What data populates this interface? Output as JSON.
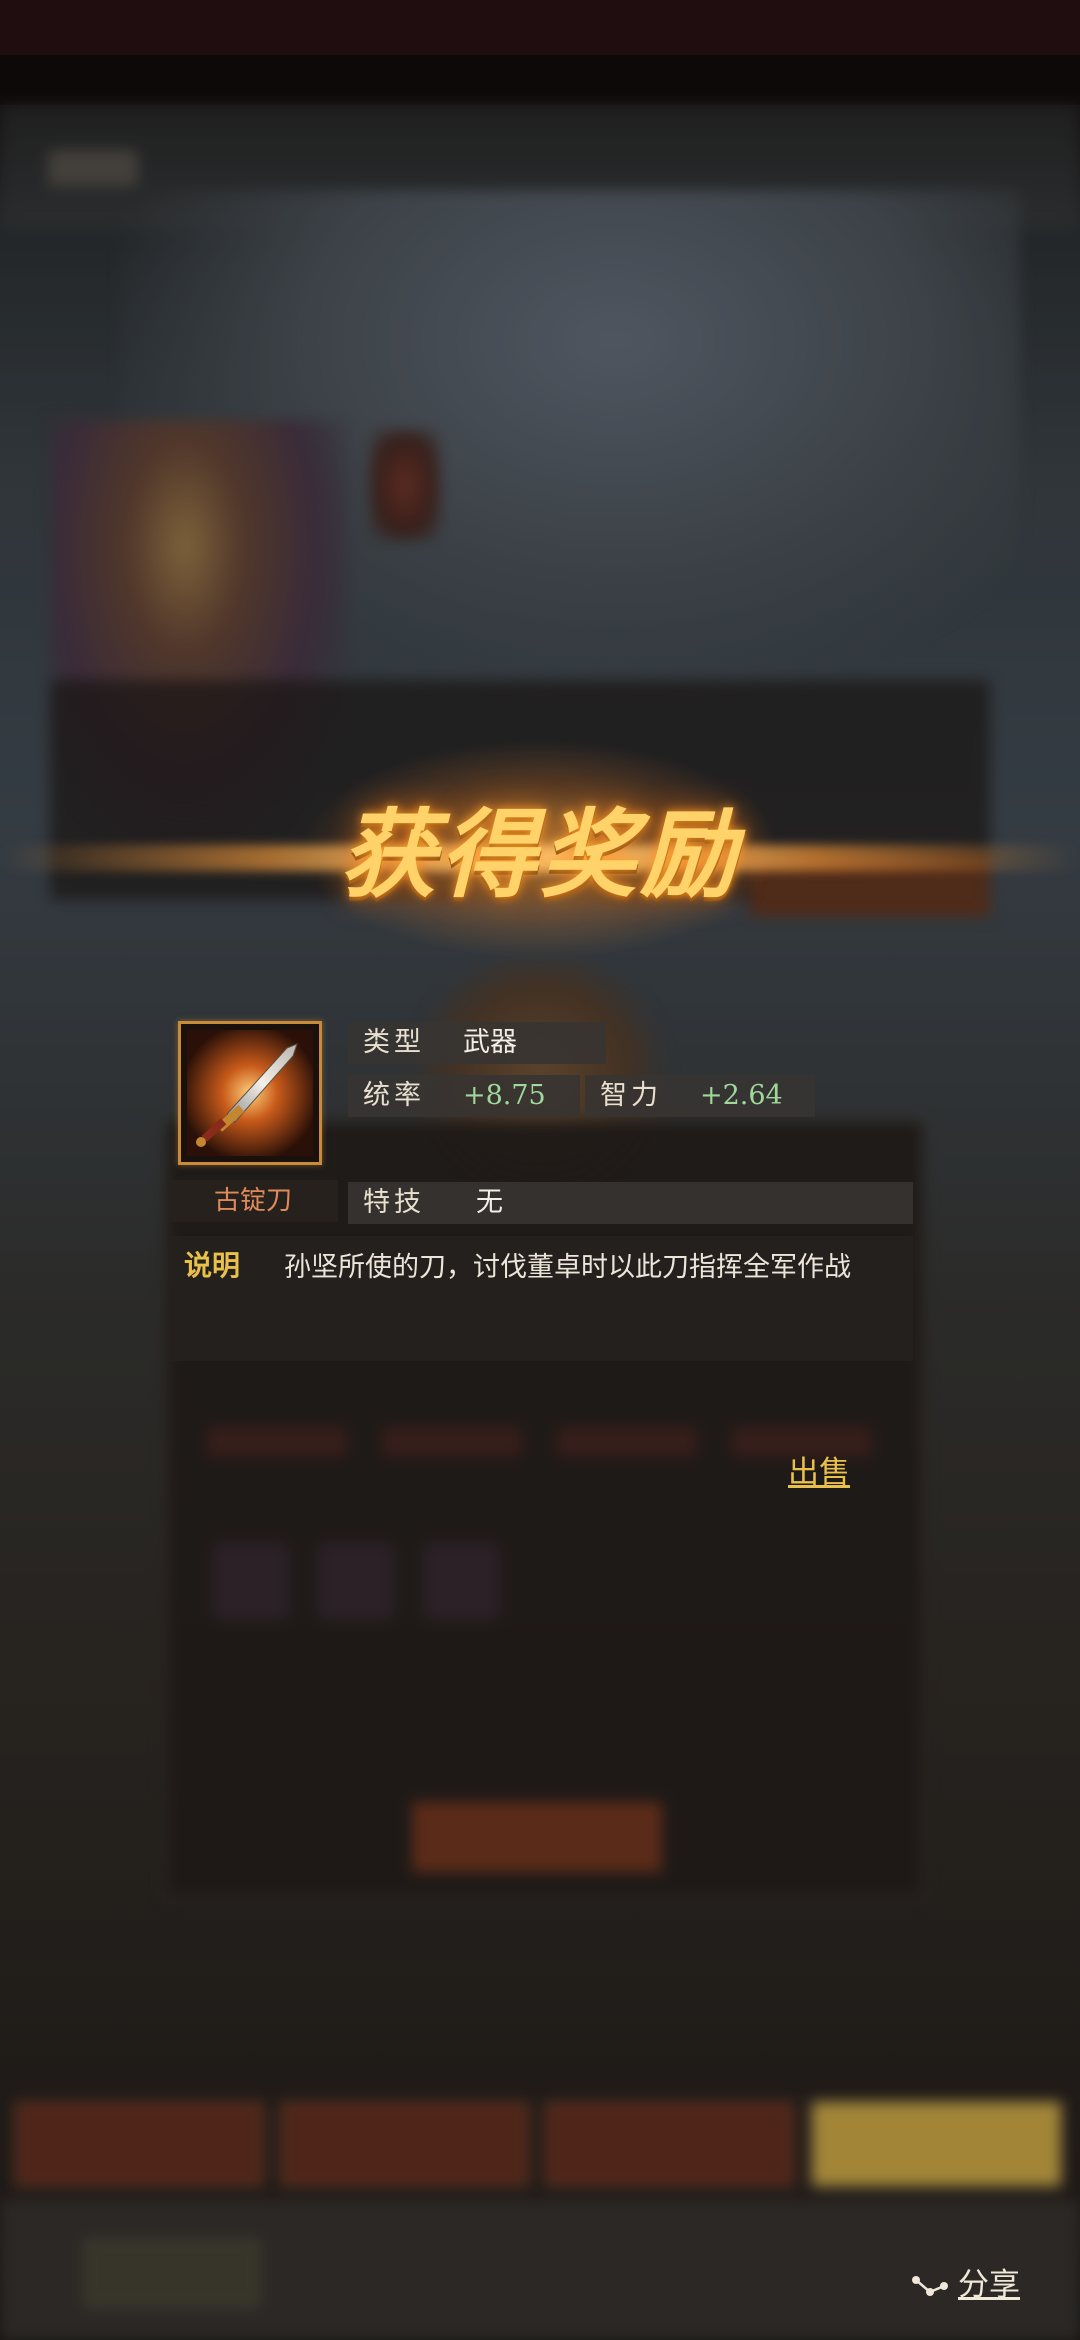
{
  "reward": {
    "title": "获得奖励"
  },
  "item": {
    "name": "古锭刀",
    "icon": "sword-icon",
    "type_label": "类型",
    "type_value": "武器",
    "stats": [
      {
        "label": "统率",
        "value": "+8.75"
      },
      {
        "label": "智力",
        "value": "+2.64"
      }
    ],
    "skill_label": "特技",
    "skill_value": "无",
    "description_label": "说明",
    "description": "孙坚所使的刀，讨伐董卓时以此刀指挥全军作战"
  },
  "actions": {
    "sell_label": "出售",
    "share_label": "分享",
    "share_icon": "share-icon"
  },
  "colors": {
    "title_gold": "#ffd36a",
    "stat_green": "#9fd89a",
    "item_name": "#e08a5a",
    "label_gold": "#e8c04a"
  }
}
